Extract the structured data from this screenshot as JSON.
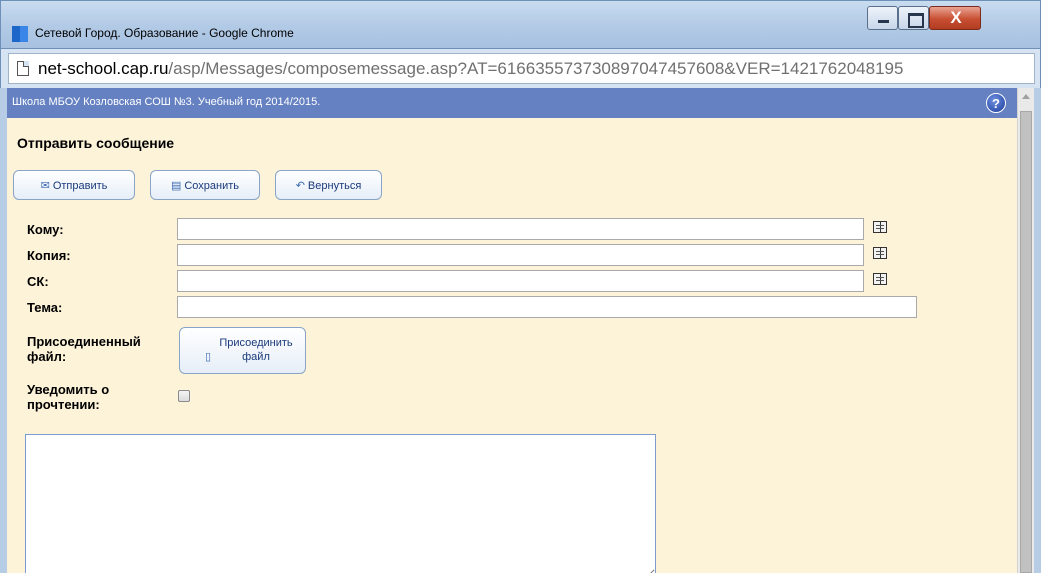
{
  "window": {
    "title": "Сетевой Город. Образование - Google Chrome",
    "close_glyph": "X"
  },
  "address_bar": {
    "host": "net-school.cap.ru",
    "path": "/asp/Messages/composemessage.asp?AT=616635573730897047457608&VER=1421762048195"
  },
  "info_bar": {
    "text": "Школа МБОУ Козловская СОШ №3. Учебный год 2014/2015.",
    "help_glyph": "?"
  },
  "compose": {
    "heading": "Отправить сообщение",
    "buttons": {
      "send": "Отправить",
      "save": "Сохранить",
      "back": "Вернуться"
    },
    "fields": {
      "to_label": "Кому:",
      "copy_label": "Копия:",
      "bcc_label": "СК:",
      "subject_label": "Тема:",
      "to_value": "",
      "copy_value": "",
      "bcc_value": "",
      "subject_value": ""
    },
    "attachment": {
      "label_line1": "Присоединенный",
      "label_line2": "файл:",
      "button_line1": "Присоединить",
      "button_line2": "файл"
    },
    "read_receipt": {
      "label_line1": "Уведомить о",
      "label_line2": "прочтении:",
      "checked": false
    },
    "body_value": ""
  },
  "colors": {
    "content_bg": "#fcf3d8",
    "info_bar_bg": "#6581c2",
    "button_text": "#1a3a7a"
  },
  "icons": {
    "send": "envelope-icon",
    "save": "floppy-icon",
    "back": "back-arrow-icon",
    "attach": "document-icon",
    "address_book": "address-book-icon"
  }
}
